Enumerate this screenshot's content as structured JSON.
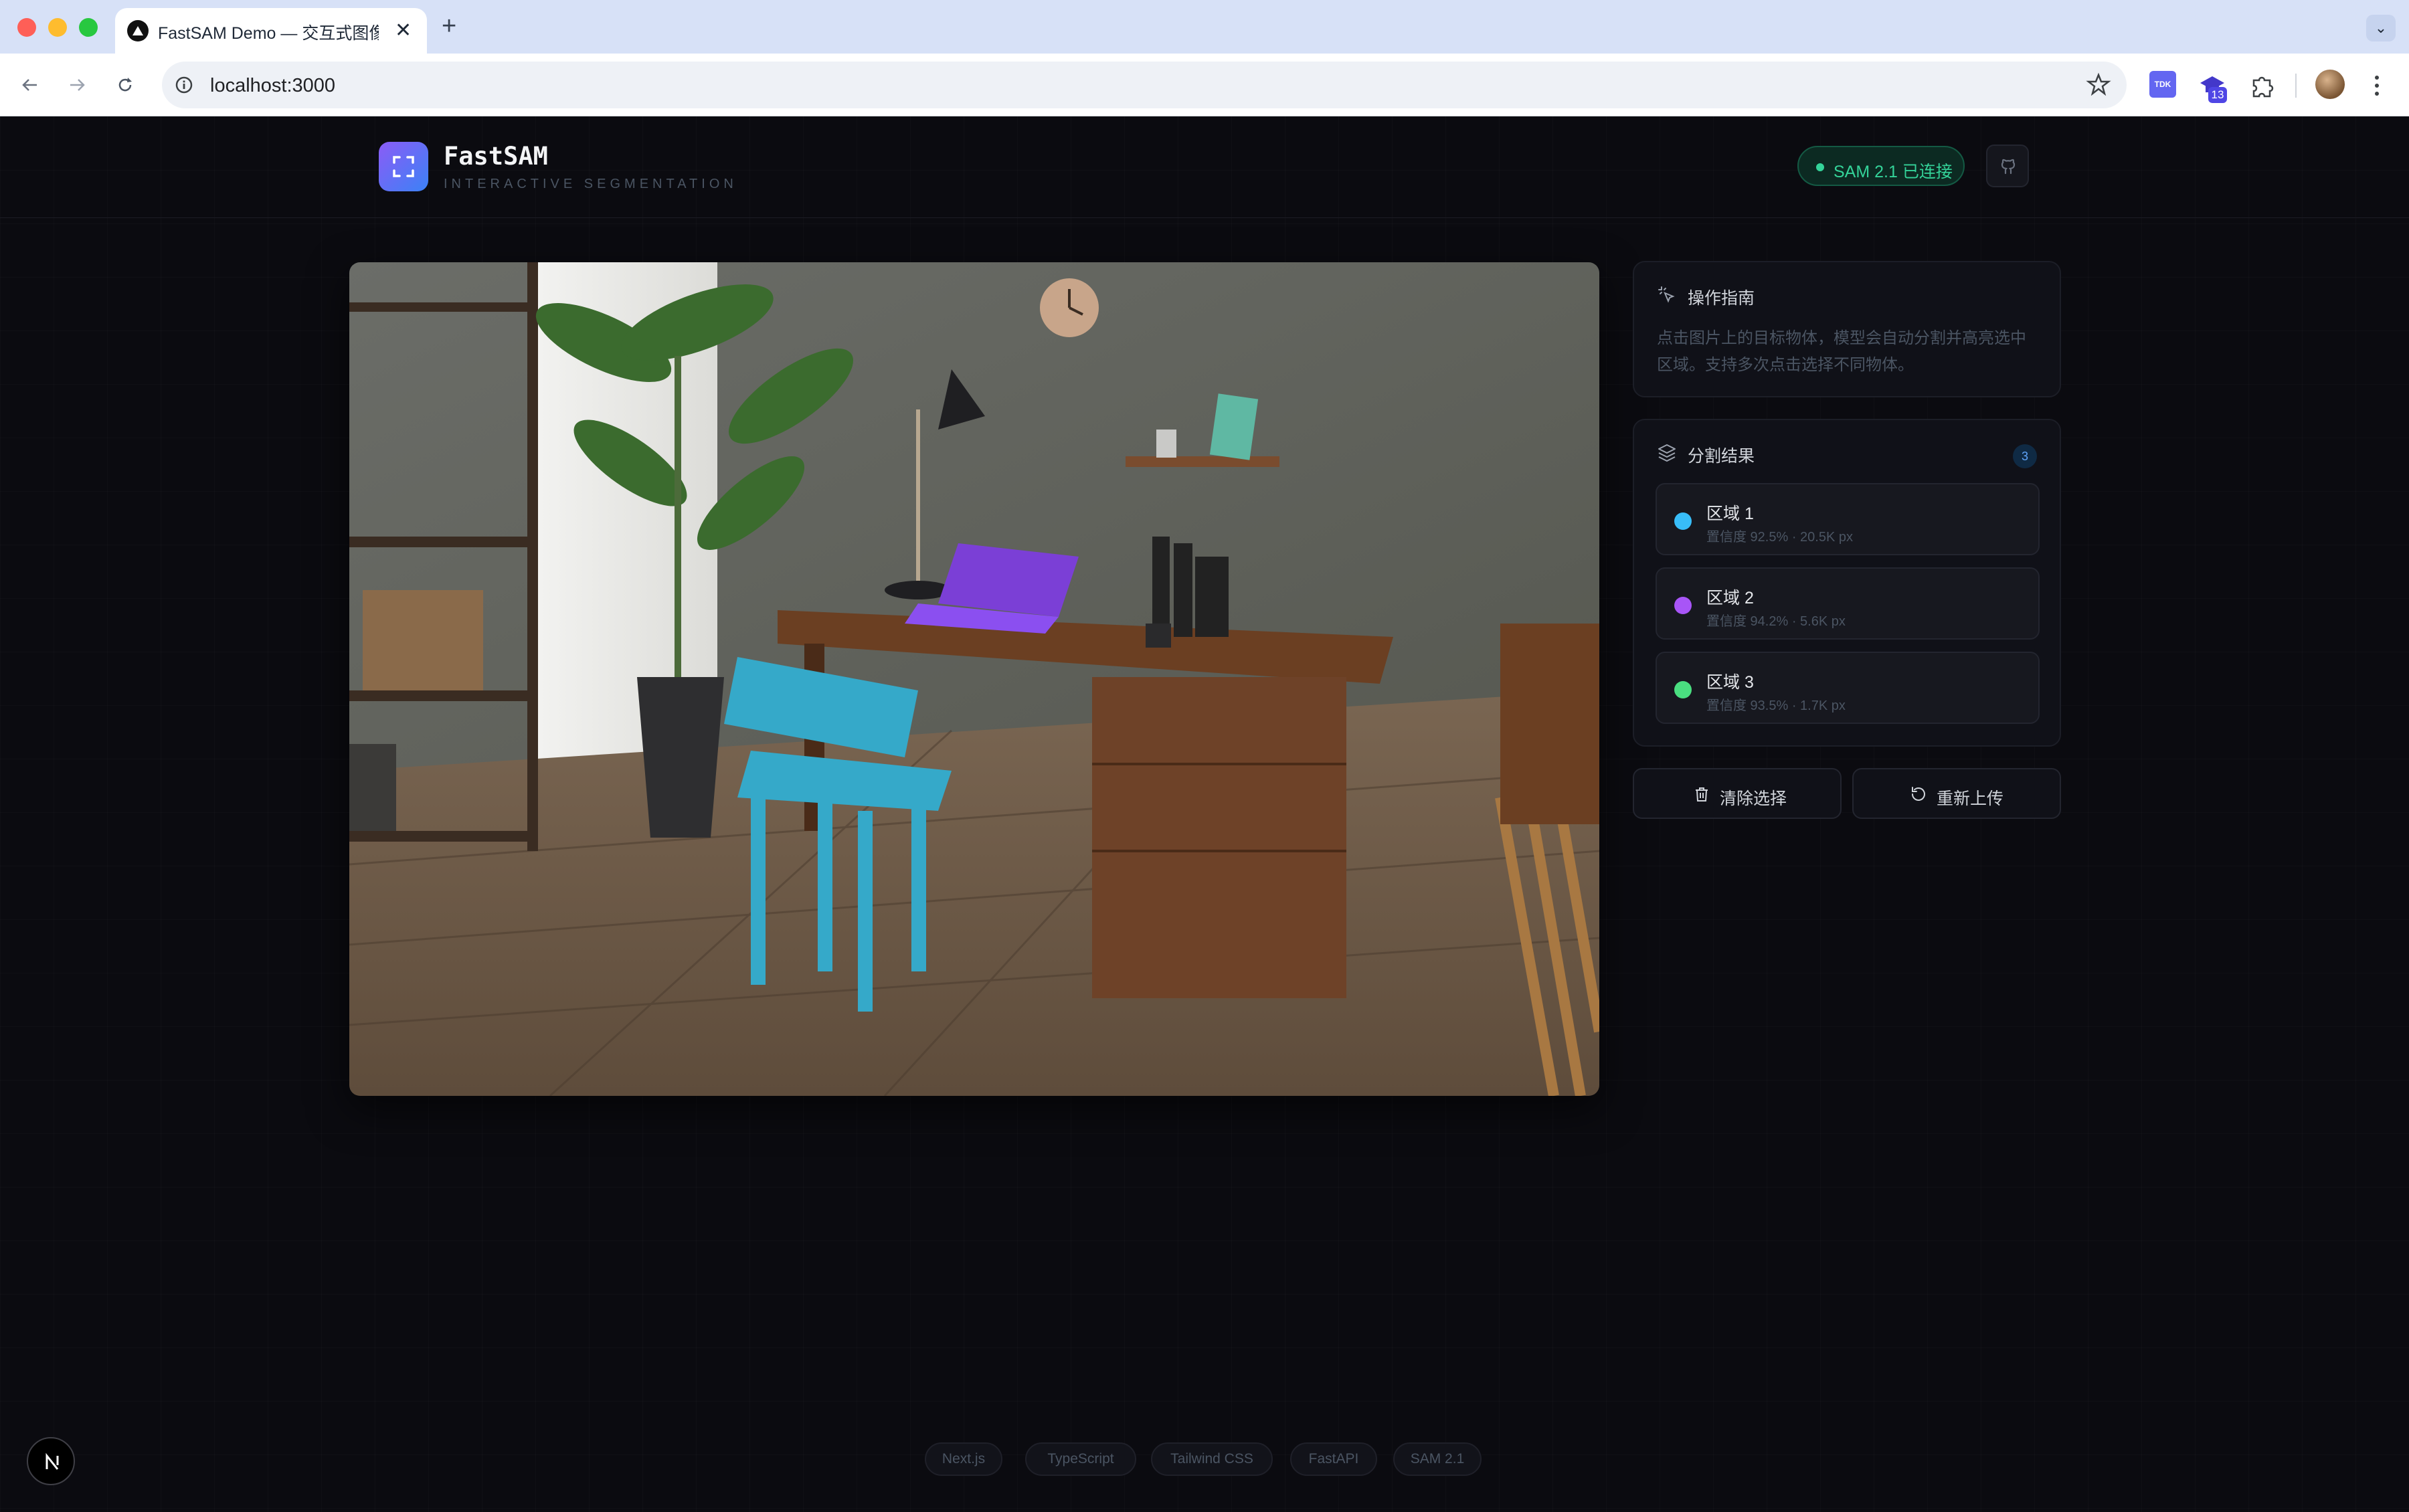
{
  "browser": {
    "tab_title": "FastSAM Demo — 交互式图像",
    "url": "localhost:3000",
    "extension_badge": "13",
    "extension_label": "TDK"
  },
  "header": {
    "brand": "FastSAM",
    "tagline": "INTERACTIVE SEGMENTATION",
    "status": "SAM 2.1 已连接"
  },
  "guide": {
    "title": "操作指南",
    "text": "点击图片上的目标物体，模型会自动分割并高亮选中区域。支持多次点击选择不同物体。"
  },
  "results": {
    "title": "分割结果",
    "count": "3",
    "items": [
      {
        "name": "区域 1",
        "meta": "置信度 92.5% · 20.5K px",
        "color": "#38bdf8"
      },
      {
        "name": "区域 2",
        "meta": "置信度 94.2% · 5.6K px",
        "color": "#a855f7"
      },
      {
        "name": "区域 3",
        "meta": "置信度 93.5% · 1.7K px",
        "color": "#4ade80"
      }
    ]
  },
  "actions": {
    "clear": "清除选择",
    "reupload": "重新上传"
  },
  "footer": {
    "tech": [
      "Next.js",
      "TypeScript",
      "Tailwind CSS",
      "FastAPI",
      "SAM 2.1"
    ]
  },
  "colors": {
    "accent_green": "#34d399",
    "background": "#0b0b10"
  }
}
